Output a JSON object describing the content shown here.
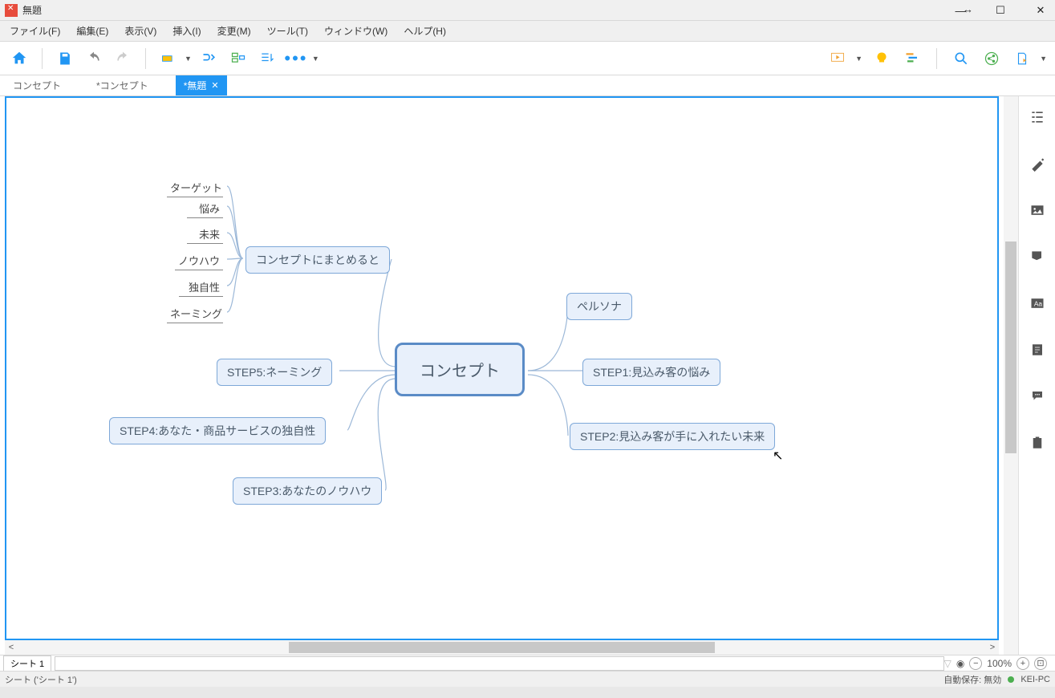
{
  "window": {
    "title": "無題"
  },
  "menu": {
    "file": "ファイル(F)",
    "edit": "編集(E)",
    "view": "表示(V)",
    "insert": "挿入(I)",
    "change": "変更(M)",
    "tool": "ツール(T)",
    "window": "ウィンドウ(W)",
    "help": "ヘルプ(H)"
  },
  "tabs": {
    "t1": "コンセプト",
    "t2": "*コンセプト",
    "t3": "*無題"
  },
  "mindmap": {
    "center": "コンセプト",
    "r1": "ペルソナ",
    "r2": "STEP1:見込み客の悩み",
    "r3": "STEP2:見込み客が手に入れたい未来",
    "l1": "コンセプトにまとめると",
    "l2": "STEP5:ネーミング",
    "l3": "STEP4:あなた・商品サービスの独自性",
    "l4": "STEP3:あなたのノウハウ",
    "leaf1": "ターゲット",
    "leaf2": "悩み",
    "leaf3": "未来",
    "leaf4": "ノウハウ",
    "leaf5": "独自性",
    "leaf6": "ネーミング"
  },
  "sheet": {
    "name": "シート 1"
  },
  "zoom": {
    "value": "100%"
  },
  "status": {
    "breadcrumb": "シート ('シート 1')",
    "autosave": "自動保存: 無効",
    "host": "KEI-PC"
  }
}
